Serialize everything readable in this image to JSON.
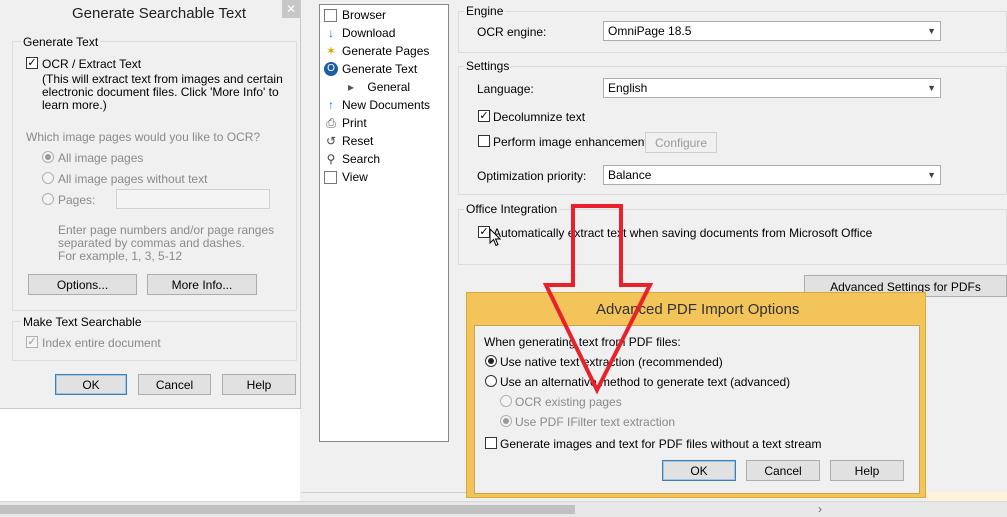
{
  "left_dialog": {
    "title": "Generate Searchable Text",
    "close_glyph": "✕",
    "group_generate": "Generate Text",
    "ocr_label": "OCR / Extract Text",
    "ocr_desc": [
      "(This will extract text from images and certain",
      "electronic document files.  Click 'More Info' to",
      "learn more.)"
    ],
    "question": "Which image pages would you like to OCR?",
    "radio_all": "All image pages",
    "radio_without": "All image pages without text",
    "radio_pages": "Pages:",
    "hint": [
      "Enter page numbers and/or page ranges",
      "separated by commas and dashes.",
      "For example, 1, 3, 5-12"
    ],
    "options_btn": "Options...",
    "moreinfo_btn": "More Info...",
    "group_searchable": "Make Text Searchable",
    "index_label": "Index entire document",
    "ok": "OK",
    "cancel": "Cancel",
    "help": "Help"
  },
  "tree": {
    "items": [
      "Browser",
      "Download",
      "Generate Pages",
      "Generate Text",
      "General",
      "New Documents",
      "Print",
      "Reset",
      "Search",
      "View"
    ],
    "expander": "▸"
  },
  "settings": {
    "engine_group": "Engine",
    "ocr_engine_label": "OCR engine:",
    "ocr_engine_value": "OmniPage 18.5",
    "settings_group": "Settings",
    "language_label": "Language:",
    "language_value": "English",
    "decolumnize": "Decolumnize text",
    "enhance": "Perform image enhancement",
    "configure_btn": "Configure",
    "optimization_label": "Optimization priority:",
    "optimization_value": "Balance",
    "office_group": "Office Integration",
    "office_auto": "Automatically extract text when saving documents from Microsoft Office",
    "advanced_btn": "Advanced Settings for PDFs"
  },
  "pdf_dialog": {
    "title": "Advanced PDF Import Options",
    "intro": "When generating text from PDF files:",
    "native": "Use native text extraction (recommended)",
    "alternative": "Use an alternative method to generate text (advanced)",
    "ocr_existing": "OCR existing pages",
    "ifilter": "Use PDF IFilter text extraction",
    "generate_images": "Generate images and text for PDF files without a text stream",
    "ok": "OK",
    "cancel": "Cancel",
    "help": "Help"
  },
  "scroll_arrow": "›",
  "colors": {
    "annotation_arrow": "#e8212b",
    "dialog_frame": "#f2c45a"
  }
}
